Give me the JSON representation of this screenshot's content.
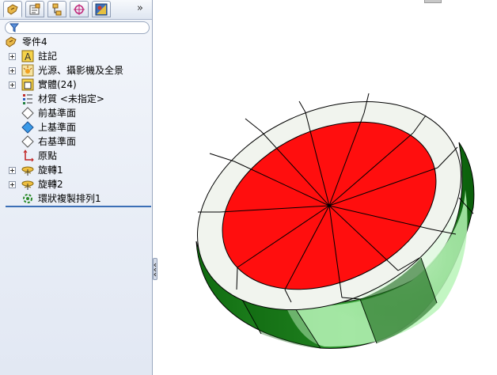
{
  "tree": {
    "root": "零件4",
    "items": [
      {
        "label": "註記",
        "expandable": true,
        "icon": "annotation-icon"
      },
      {
        "label": "光源、攝影機及全景",
        "expandable": true,
        "icon": "lights-camera-icon"
      },
      {
        "label": "實體(24)",
        "expandable": true,
        "icon": "solid-bodies-icon"
      },
      {
        "label": "材質 <未指定>",
        "expandable": false,
        "icon": "material-icon"
      },
      {
        "label": "前基準面",
        "expandable": false,
        "icon": "plane-icon"
      },
      {
        "label": "上基準面",
        "expandable": false,
        "icon": "plane-selected-icon"
      },
      {
        "label": "右基準面",
        "expandable": false,
        "icon": "plane-icon"
      },
      {
        "label": "原點",
        "expandable": false,
        "icon": "origin-icon"
      },
      {
        "label": "旋轉1",
        "expandable": true,
        "icon": "revolve-icon"
      },
      {
        "label": "旋轉2",
        "expandable": true,
        "icon": "revolve-icon"
      },
      {
        "label": "環狀複製排列1",
        "expandable": false,
        "icon": "circular-pattern-icon"
      }
    ]
  },
  "tabs": [
    "feature-manager-tab",
    "property-manager-tab",
    "configuration-manager-tab",
    "dimxpert-tab",
    "display-manager-tab"
  ],
  "colors": {
    "flesh": "#ff0e0e",
    "rind_white": "#f1f4ee",
    "rind_green": "#0e6e0e",
    "rind_light": "#b9f5b9"
  }
}
